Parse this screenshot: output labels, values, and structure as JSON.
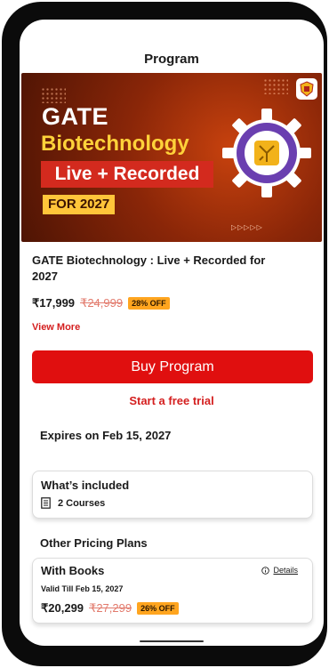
{
  "header": {
    "title": "Program"
  },
  "banner": {
    "line1": "GATE",
    "line2": "Biotechnology",
    "line3": "Live + Recorded",
    "line4": "FOR 2027",
    "arrows": "▷▷▷▷▷"
  },
  "program": {
    "name": "GATE Biotechnology : Live + Recorded for 2027",
    "price": "₹17,999",
    "mrp": "₹24,999",
    "discount": "28% OFF",
    "view_more": "View More"
  },
  "actions": {
    "buy_label": "Buy Program",
    "trial_label": "Start a free trial"
  },
  "expiry": "Expires on Feb 15, 2027",
  "included": {
    "heading": "What’s included",
    "courses": "2 Courses"
  },
  "pricing": {
    "heading": "Other Pricing Plans",
    "plans": [
      {
        "name": "With Books",
        "details_label": "Details",
        "valid": "Valid Till Feb 15, 2027",
        "price": "₹20,299",
        "mrp": "₹27,299",
        "discount": "26% OFF"
      }
    ]
  },
  "colors": {
    "primary": "#e00f0f",
    "discount_badge": "#ffa51f",
    "banner_yellow": "#ffd23a",
    "gear_purple": "#6a3fb0"
  },
  "icons": [
    "logo-badge-icon",
    "gear-circuit-icon",
    "course-book-icon",
    "info-icon"
  ]
}
